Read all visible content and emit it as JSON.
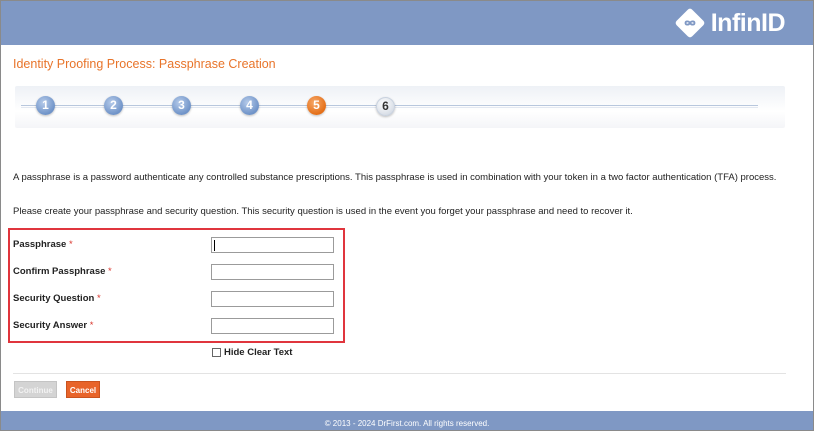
{
  "brand": {
    "logo_text": "InfinID"
  },
  "page": {
    "title": "Identity Proofing Process: Passphrase Creation"
  },
  "steps": [
    {
      "label": "1",
      "state": "done"
    },
    {
      "label": "2",
      "state": "done"
    },
    {
      "label": "3",
      "state": "done"
    },
    {
      "label": "4",
      "state": "done"
    },
    {
      "label": "5",
      "state": "active"
    },
    {
      "label": "6",
      "state": "pending"
    }
  ],
  "intro": {
    "paragraph1": "A passphrase is a password authenticate any controlled substance prescriptions. This passphrase is used in combination with your token in a two factor authentication (TFA) process.",
    "paragraph2": "Please create your passphrase and security question. This security question is used in the event you forget your passphrase and need to recover it."
  },
  "form": {
    "required_marker": "*",
    "fields": [
      {
        "label": "Passphrase",
        "value": ""
      },
      {
        "label": "Confirm Passphrase",
        "value": ""
      },
      {
        "label": "Security Question",
        "value": ""
      },
      {
        "label": "Security Answer",
        "value": ""
      }
    ],
    "hide_clear_text": {
      "label": "Hide Clear Text",
      "checked": false
    }
  },
  "buttons": {
    "continue": "Continue",
    "cancel": "Cancel"
  },
  "footer": {
    "text": "© 2013 - 2024 DrFirst.com. All rights reserved."
  },
  "colors": {
    "header": "#7f98c4",
    "accent": "#e8742a",
    "highlight_border": "#e0353d"
  },
  "icons": {
    "logo": "infinity-icon"
  }
}
